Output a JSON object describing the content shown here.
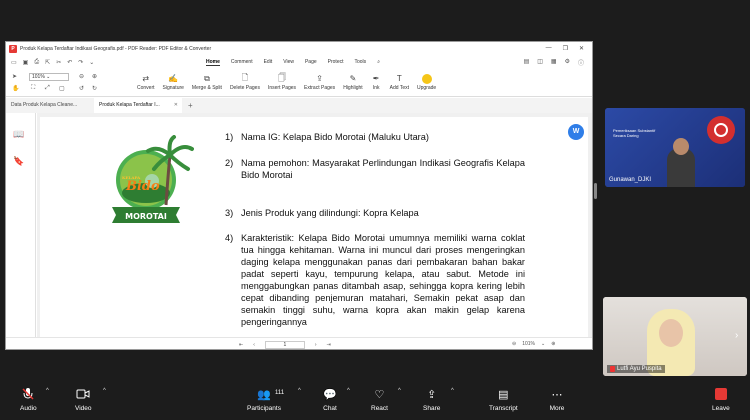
{
  "app": {
    "title": "Produk Kelapa Terdaftar Indikasi Geografis.pdf - PDF Reader: PDF Editor & Converter",
    "menus": [
      "Home",
      "Comment",
      "Edit",
      "View",
      "Page",
      "Protect",
      "Tools"
    ],
    "active_menu": "Home",
    "zoom": "101%",
    "tools": [
      "Convert",
      "Signature",
      "Merge & Split",
      "Delete Pages",
      "Insert Pages",
      "Extract Pages",
      "Highlight",
      "Ink",
      "Add Text",
      "Upgrade"
    ],
    "tabs": [
      {
        "label": "Data Produk Kelapa Cleane..."
      },
      {
        "label": "Produk Kelapa Terdaftar I..."
      }
    ],
    "status": {
      "page": "1",
      "zoom": "101%"
    }
  },
  "document": {
    "logo_top_text": "KELAPA",
    "logo_brand": "Bido",
    "logo_ribbon": "MOROTAI",
    "badge_letter": "W",
    "items": [
      {
        "num": "1)",
        "text": "Nama IG: Kelapa Bido Morotai (Maluku Utara)"
      },
      {
        "num": "2)",
        "text": "Nama pemohon: Masyarakat Perlindungan Indikasi Geografis Kelapa Bido Morotai"
      },
      {
        "num": "3)",
        "text": "Jenis Produk yang dilindungi: Kopra Kelapa"
      },
      {
        "num": "4)",
        "text": "Karakteristik: Kelapa Bido Morotai umumnya memiliki warna coklat tua hingga kehitaman. Warna ini muncul dari proses mengeringkan daging kelapa menggunakan panas dari pembakaran bahan bakar padat seperti kayu, tempurung kelapa, atau sabut. Metode ini menggabungkan panas ditambah asap, sehingga kopra kering lebih cepat dibanding penjemuran matahari, Semakin pekat asap dan semakin tinggi suhu, warna kopra akan makin gelap karena pengeringannya"
      }
    ]
  },
  "participants": [
    {
      "name": "Gunawan_DJKI",
      "slide_text": "Pemeriksaan Substantif Secara Daring"
    },
    {
      "name": "Lutfi Ayu Puspita"
    }
  ],
  "bottom_bar": {
    "audio": "Audio",
    "video": "Video",
    "participants": "Participants",
    "participant_count": "111",
    "chat": "Chat",
    "react": "React",
    "share": "Share",
    "transcript": "Transcript",
    "more": "More",
    "leave": "Leave"
  }
}
